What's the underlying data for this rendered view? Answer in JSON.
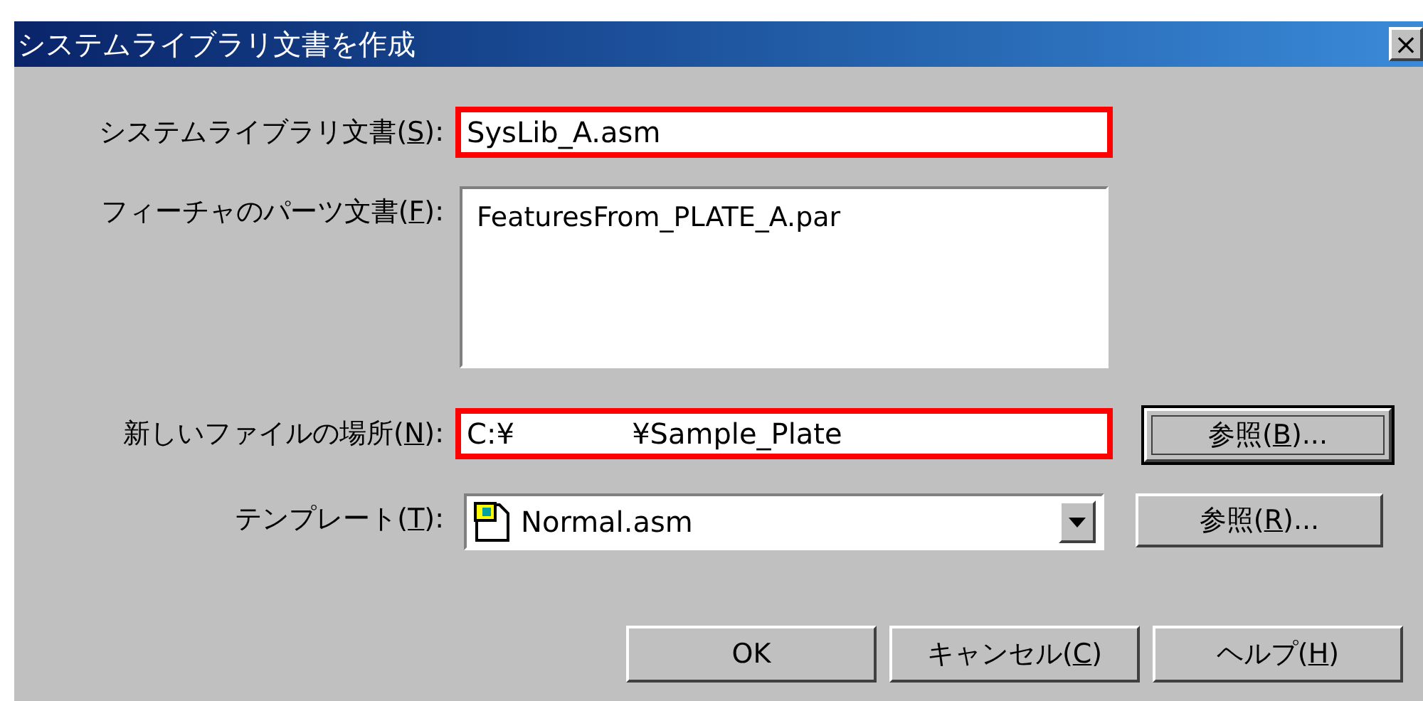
{
  "window": {
    "title": "システムライブラリ文書を作成",
    "close": "×"
  },
  "fields": [
    {
      "kind": "text",
      "label": "システムライブラリ文書(",
      "key": "S",
      "label_end": "):",
      "value": "SysLib_A.asm",
      "highlighted": true
    },
    {
      "kind": "list",
      "label": "フィーチャのパーツ文書(",
      "key": "F",
      "label_end": "):",
      "items": [
        "FeaturesFrom_PLATE_A.par"
      ],
      "highlighted": false
    },
    {
      "kind": "text",
      "label": "新しいファイルの場所(",
      "key": "N",
      "label_end": "):",
      "value": "C:¥             ¥Sample_Plate",
      "highlighted": true,
      "button": {
        "label": "参照(",
        "key": "B",
        "label_end": ")...",
        "focused": true
      }
    },
    {
      "kind": "combo",
      "label": "テンプレート(",
      "key": "T",
      "label_end": "):",
      "value": "Normal.asm",
      "highlighted": false,
      "button": {
        "label": "参照(",
        "key": "R",
        "label_end": ")...",
        "focused": false
      }
    }
  ],
  "buttons": [
    {
      "label": "OK"
    },
    {
      "label": "キャンセル(",
      "key": "C",
      "label_end": ")"
    },
    {
      "label": "ヘルプ(",
      "key": "H",
      "label_end": ")"
    }
  ]
}
